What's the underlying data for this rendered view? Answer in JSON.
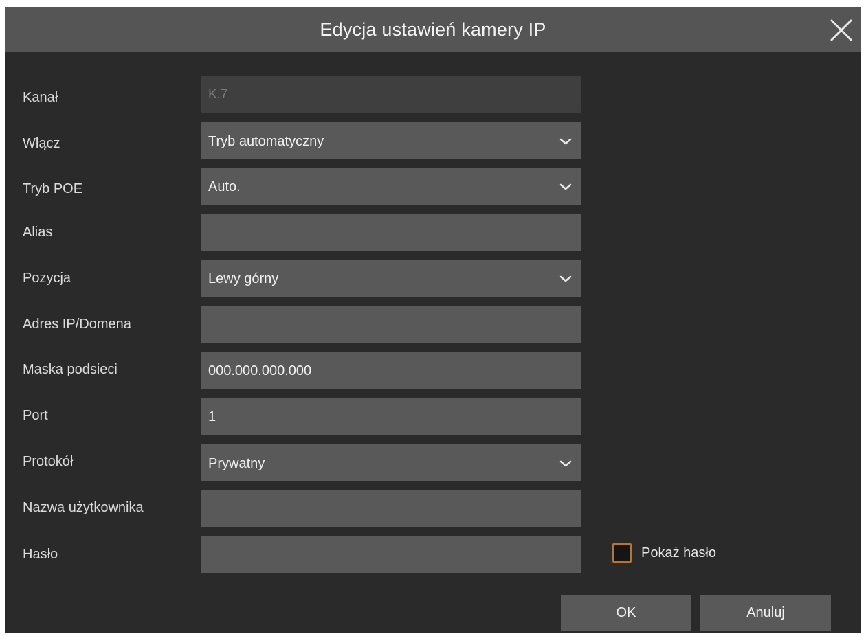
{
  "dialog": {
    "title": "Edycja ustawień kamery IP",
    "close_icon": "close-icon"
  },
  "fields": {
    "channel": {
      "label": "Kanał",
      "value": "K.7"
    },
    "enable": {
      "label": "Włącz",
      "value": "Tryb automatyczny"
    },
    "poe_mode": {
      "label": "Tryb POE",
      "value": "Auto."
    },
    "alias": {
      "label": "Alias",
      "value": ""
    },
    "position": {
      "label": "Pozycja",
      "value": "Lewy górny"
    },
    "ip_address": {
      "label": "Adres IP/Domena",
      "value": ""
    },
    "subnet_mask": {
      "label": "Maska podsieci",
      "value": "000.000.000.000"
    },
    "port": {
      "label": "Port",
      "value": "1"
    },
    "protocol": {
      "label": "Protokół",
      "value": "Prywatny"
    },
    "username": {
      "label": "Nazwa użytkownika",
      "value": ""
    },
    "password": {
      "label": "Hasło",
      "value": ""
    }
  },
  "show_password": {
    "label": "Pokaż hasło",
    "checked": false
  },
  "buttons": {
    "ok": "OK",
    "cancel": "Anuluj"
  },
  "colors": {
    "background": "#2a2a2a",
    "titlebar": "#555555",
    "field": "#595959",
    "disabled_field": "#3f3f3f",
    "checkbox_border": "#c0741f"
  }
}
